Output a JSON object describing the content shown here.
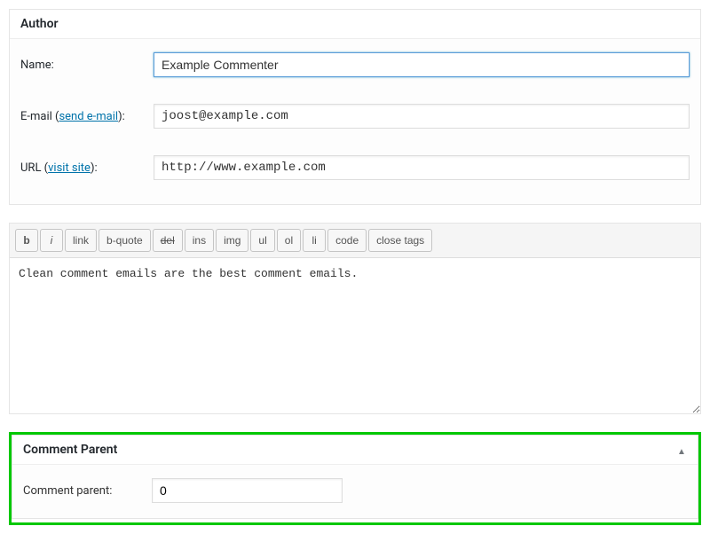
{
  "author": {
    "title": "Author",
    "name_label": "Name:",
    "name_value": "Example Commenter",
    "email_label_prefix": "E-mail (",
    "email_link": "send e-mail",
    "email_label_suffix": "):",
    "email_value": "joost@example.com",
    "url_label_prefix": "URL (",
    "url_link": "visit site",
    "url_label_suffix": "):",
    "url_value": "http://www.example.com"
  },
  "editor": {
    "buttons": [
      "b",
      "i",
      "link",
      "b-quote",
      "del",
      "ins",
      "img",
      "ul",
      "ol",
      "li",
      "code",
      "close tags"
    ],
    "content": "Clean comment emails are the best comment emails."
  },
  "comment_parent": {
    "title": "Comment Parent",
    "label": "Comment parent:",
    "value": "0"
  }
}
